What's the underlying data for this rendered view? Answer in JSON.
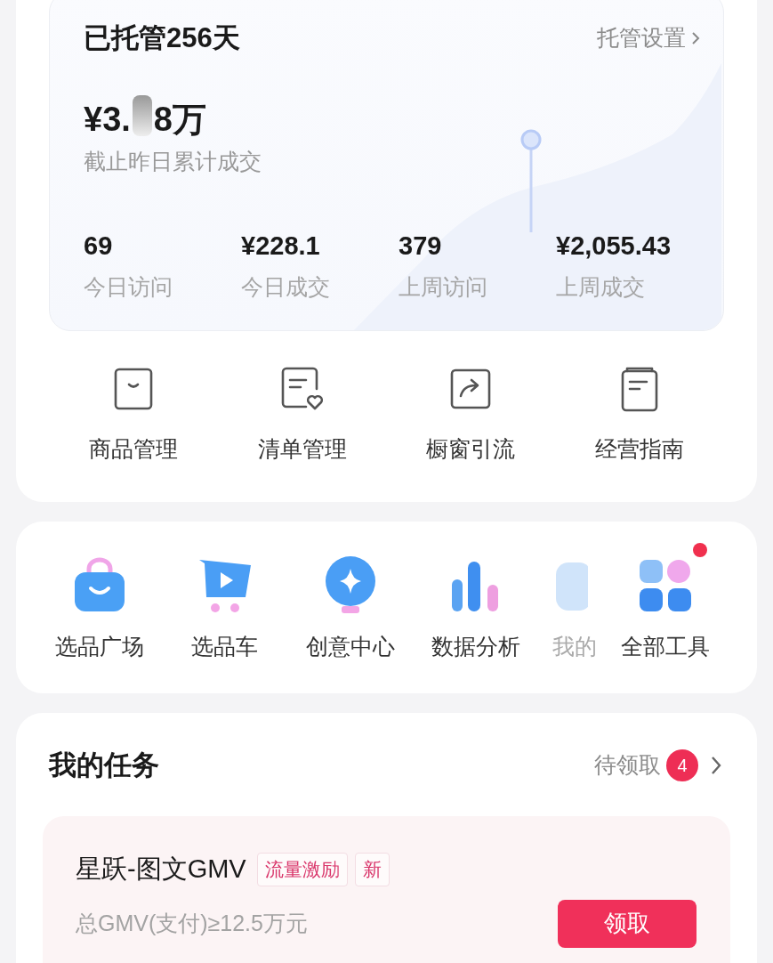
{
  "hosting": {
    "title": "已托管256天",
    "settings_link": "托管设置",
    "total_prefix": "¥3.",
    "total_suffix": "8万",
    "total_label": "截止昨日累计成交",
    "stats": [
      {
        "value": "69",
        "label": "今日访问"
      },
      {
        "value": "¥228.1",
        "label": "今日成交"
      },
      {
        "value": "379",
        "label": "上周访问"
      },
      {
        "value": "¥2,055.43",
        "label": "上周成交"
      }
    ]
  },
  "shortcuts": [
    {
      "label": "商品管理"
    },
    {
      "label": "清单管理"
    },
    {
      "label": "橱窗引流"
    },
    {
      "label": "经营指南"
    }
  ],
  "tools": [
    {
      "label": "选品广场",
      "kind": "normal",
      "dot": false
    },
    {
      "label": "选品车",
      "kind": "normal",
      "dot": false
    },
    {
      "label": "创意中心",
      "kind": "normal",
      "dot": false
    },
    {
      "label": "数据分析",
      "kind": "normal",
      "dot": false
    },
    {
      "label": "我的",
      "kind": "covered",
      "dot": false
    },
    {
      "label": "全部工具",
      "kind": "normal",
      "dot": true
    }
  ],
  "tasks": {
    "title": "我的任务",
    "pending_label": "待领取",
    "pending_count": "4",
    "items": [
      {
        "title": "星跃-图文GMV",
        "tags": [
          "流量激励",
          "新"
        ],
        "requirement": "总GMV(支付)≥12.5万元",
        "action": "领取"
      }
    ]
  }
}
